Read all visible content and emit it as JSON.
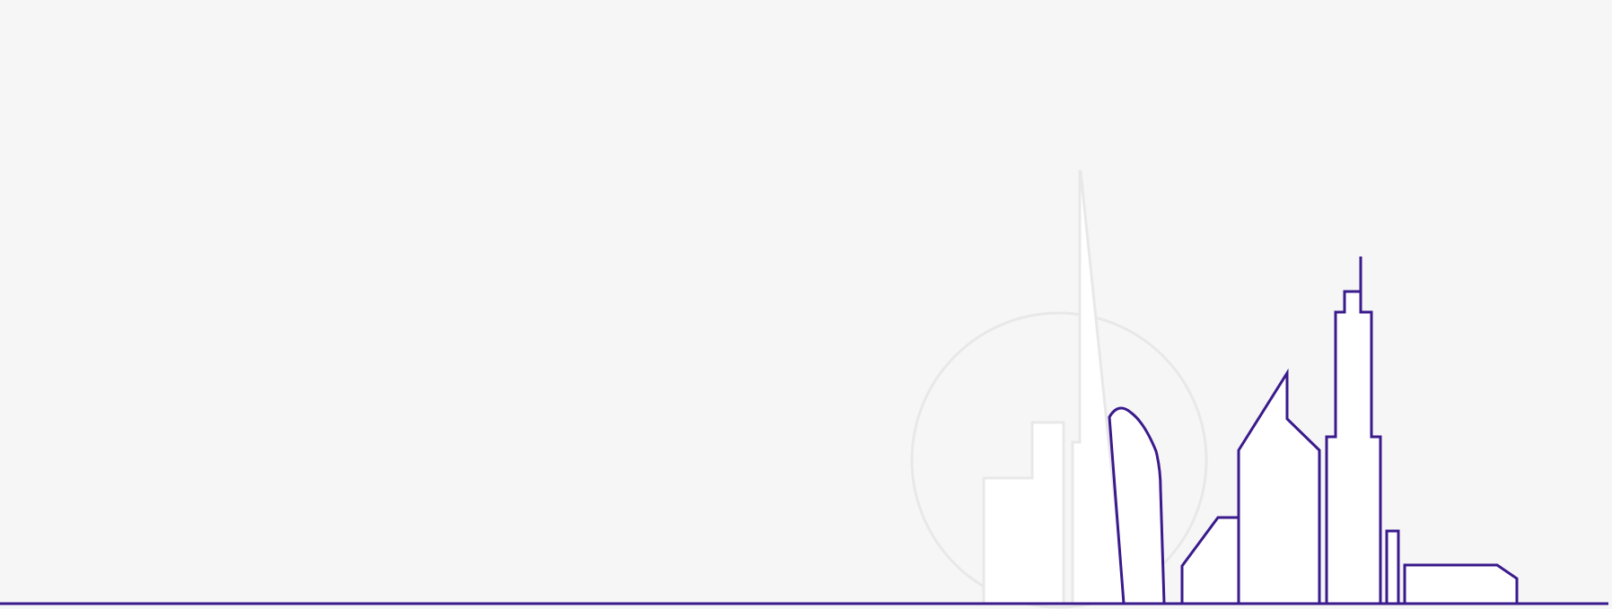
{
  "colors": {
    "background": "#f6f6f6",
    "outline_primary": "#3a1a8c",
    "outline_faded": "#e8e8e8",
    "fill": "#ffffff"
  },
  "scene": {
    "icon": "city-skyline-illustration"
  }
}
